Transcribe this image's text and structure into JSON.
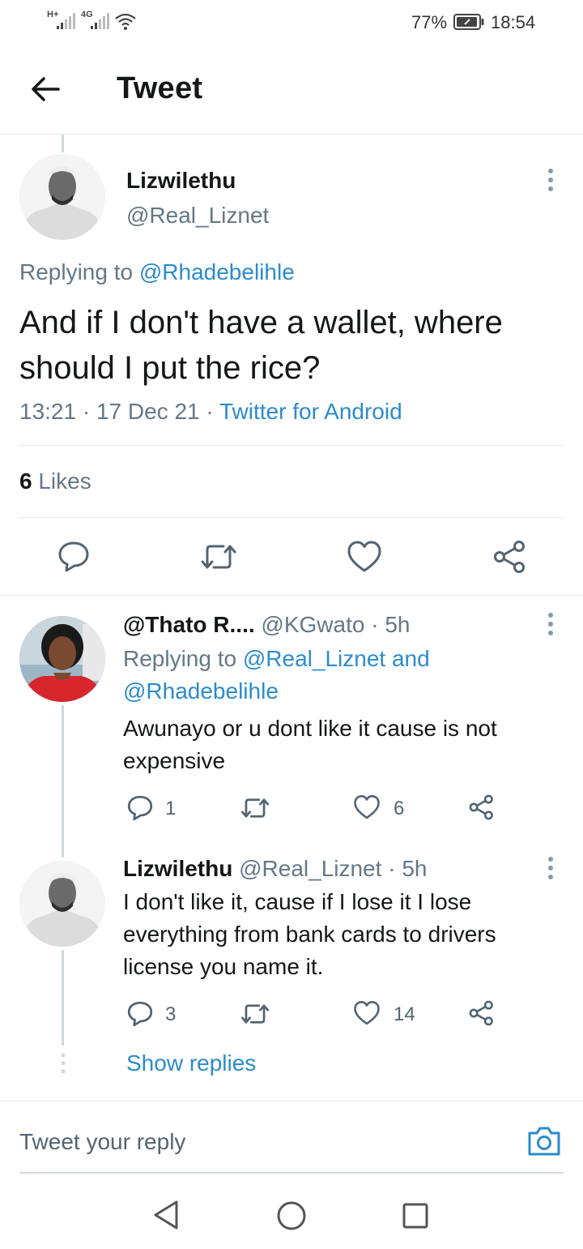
{
  "status_bar": {
    "network_1": "H+",
    "network_2": "4G",
    "battery": "77%",
    "time": "18:54"
  },
  "header": {
    "title": "Tweet"
  },
  "main_tweet": {
    "display_name": "Lizwilethu",
    "handle": "@Real_Liznet",
    "replying_prefix": "Replying to",
    "replying_to": "@Rhadebelihle",
    "text": "And if I don't have a wallet, where should I put the rice?",
    "time": "13:21",
    "date": "17 Dec 21",
    "source": "Twitter for Android",
    "likes_count": "6",
    "likes_label": "Likes"
  },
  "replies": [
    {
      "display_name": "@Thato R....",
      "handle": "@KGwato",
      "age": "5h",
      "replying_prefix": "Replying to",
      "replying_to_line1": "@Real_Liznet and",
      "replying_to_line2": "@Rhadebelihle",
      "text_line1": "Awunayo or u dont like it cause is not",
      "text_line2": "expensive",
      "reply_count": "1",
      "like_count": "6"
    },
    {
      "display_name": "Lizwilethu",
      "handle": "@Real_Liznet",
      "age": "5h",
      "text_line1": "I don't like it, cause if I lose it I lose",
      "text_line2": "everything from bank cards to drivers",
      "text_line3": "license you name it.",
      "reply_count": "3",
      "like_count": "14"
    }
  ],
  "show_replies": "Show replies",
  "reply_box": {
    "placeholder": "Tweet your reply"
  },
  "colors": {
    "accent": "#2b8ccc",
    "text": "#14171a",
    "secondary": "#657786",
    "divider": "#e1e8ed"
  }
}
